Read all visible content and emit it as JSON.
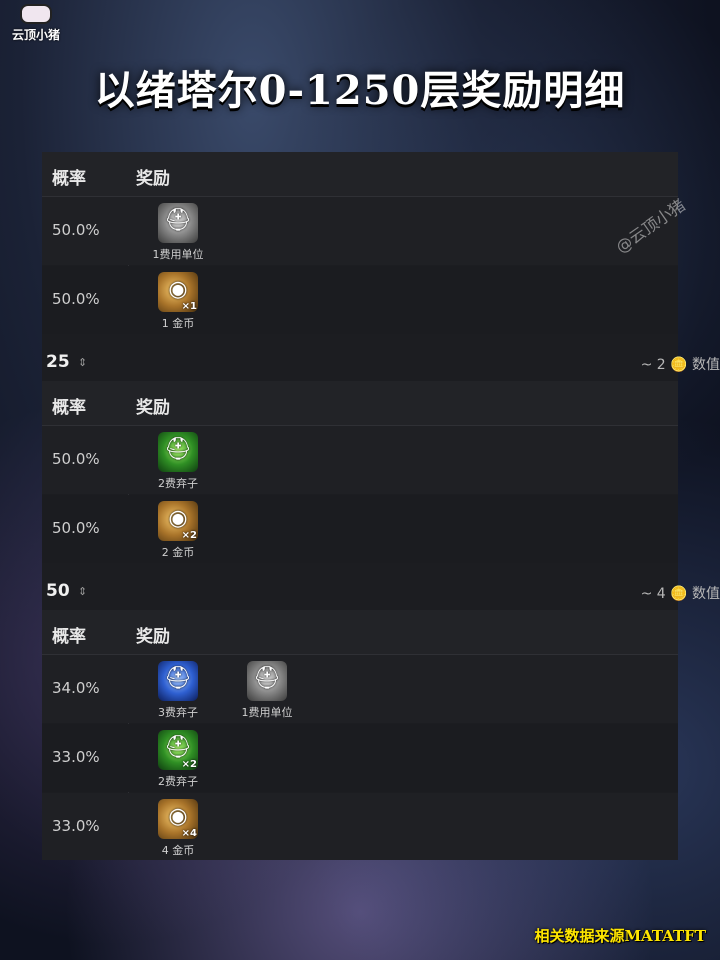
{
  "logo": {
    "text": "云顶小猪"
  },
  "title": "以绪塔尔0-1250层奖励明细",
  "watermark": "@云顶小猪",
  "source_note": "相关数据来源MATATFT",
  "columns": {
    "rate": "概率",
    "reward": "奖励"
  },
  "sections": [
    {
      "level": "",
      "cost": "",
      "rows": [
        {
          "rate": "50.0%",
          "rewards": [
            {
              "icon": "silver-champion-icon",
              "mult": "",
              "label": "1费用单位"
            }
          ]
        },
        {
          "rate": "50.0%",
          "rewards": [
            {
              "icon": "gold-coin-icon",
              "mult": "×1",
              "label": "1 金币"
            }
          ]
        }
      ]
    },
    {
      "level": "25",
      "cost": "~ 2 🪙 数值",
      "rows": [
        {
          "rate": "50.0%",
          "rewards": [
            {
              "icon": "green-champion-icon",
              "mult": "",
              "label": "2费弃子"
            }
          ]
        },
        {
          "rate": "50.0%",
          "rewards": [
            {
              "icon": "gold-coin-icon",
              "mult": "×2",
              "label": "2 金币"
            }
          ]
        }
      ]
    },
    {
      "level": "50",
      "cost": "~ 4 🪙 数值",
      "rows": [
        {
          "rate": "34.0%",
          "rewards": [
            {
              "icon": "blue-champion-icon",
              "mult": "",
              "label": "3费弃子"
            },
            {
              "icon": "silver-champion-icon",
              "mult": "",
              "label": "1费用单位"
            }
          ]
        },
        {
          "rate": "33.0%",
          "rewards": [
            {
              "icon": "green-champion-icon",
              "mult": "×2",
              "label": "2费弃子"
            }
          ]
        },
        {
          "rate": "33.0%",
          "rewards": [
            {
              "icon": "gold-coin-icon",
              "mult": "×4",
              "label": "4 金币"
            }
          ]
        }
      ]
    }
  ],
  "sort_glyph": "⇕",
  "colors": {
    "panel": "#1c1d21",
    "accent_source": "#ffe600"
  }
}
